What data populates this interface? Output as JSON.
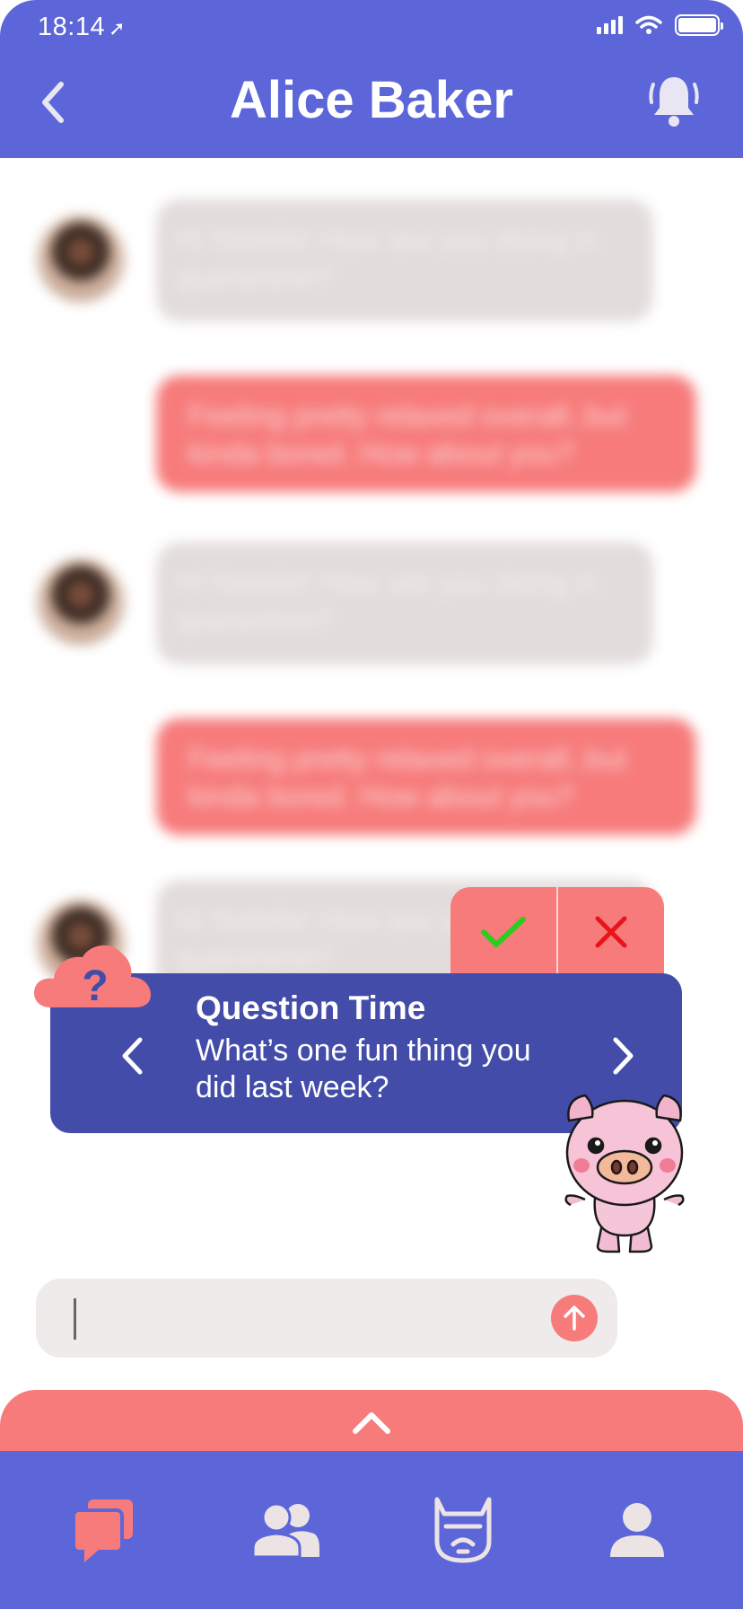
{
  "status_bar": {
    "time": "18:14"
  },
  "header": {
    "title": "Alice Baker"
  },
  "messages": [
    {
      "side": "in",
      "text": "Hi Natelie! How are you doing in quarantine?"
    },
    {
      "side": "out",
      "text": "Feeling pretty relaxed overall..but kinda bored. How about you?"
    },
    {
      "side": "in",
      "text": "Hi Natelie! How are you doing in quarantine?"
    },
    {
      "side": "out",
      "text": "Feeling pretty relaxed overall..but kinda bored. How about you?"
    },
    {
      "side": "in",
      "text": "Hi Natelie! How are you doing in quarantine?"
    }
  ],
  "question_card": {
    "badge": "?",
    "title": "Question Time",
    "text": "What’s one fun thing you did last week?"
  },
  "composer": {
    "placeholder": ""
  },
  "tabs": [
    {
      "icon": "chat-bubbles-icon",
      "active": true
    },
    {
      "icon": "friends-icon",
      "active": false
    },
    {
      "icon": "mascot-cat-icon",
      "active": false
    },
    {
      "icon": "profile-icon",
      "active": false
    }
  ],
  "colors": {
    "primary": "#5c66d9",
    "card": "#434ca8",
    "accent": "#f77b7b",
    "incoming_bubble": "#e3dcdc",
    "check": "#2ecc1f",
    "cross": "#e8141b",
    "tab_inactive": "#ece4e4"
  }
}
